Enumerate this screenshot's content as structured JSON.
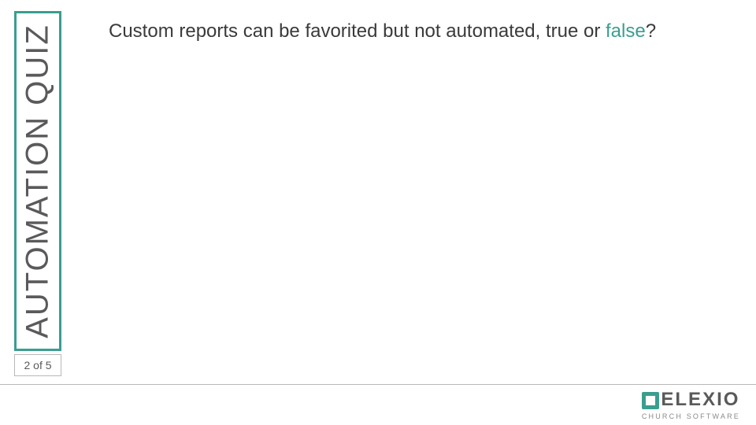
{
  "sidebar": {
    "title": "AUTOMATION QUIZ",
    "page_indicator": "2 of 5"
  },
  "question": {
    "part1": "Custom reports can be favorited but not automated, true or ",
    "part2": "false",
    "part3": "?"
  },
  "logo": {
    "name": "ELEXIO",
    "tagline": "CHURCH SOFTWARE"
  }
}
